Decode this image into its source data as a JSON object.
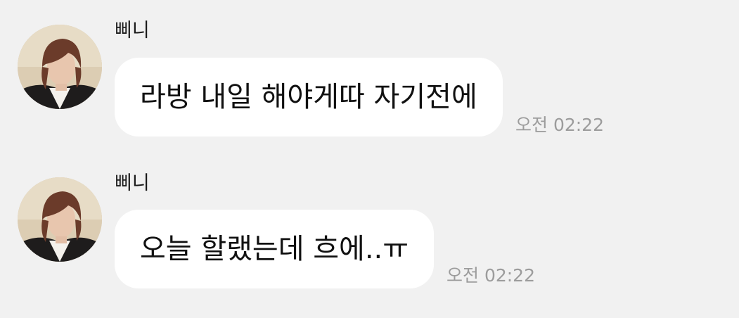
{
  "messages": [
    {
      "sender": "삐니",
      "text": "라방 내일 해야게따 자기전에",
      "time": "오전 02:22"
    },
    {
      "sender": "삐니",
      "text": "오늘 할랬는데 흐에..ㅠ",
      "time": "오전 02:22"
    }
  ]
}
